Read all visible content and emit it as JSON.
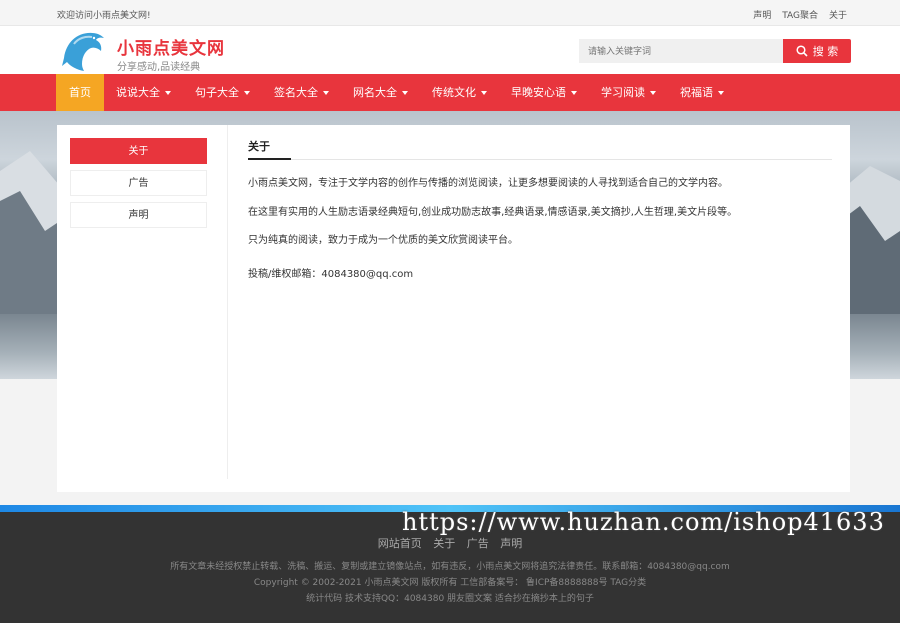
{
  "topbar": {
    "welcome": "欢迎访问小雨点美文网!",
    "links": [
      "声明",
      "TAG聚合",
      "关于"
    ]
  },
  "header": {
    "site_title": "小雨点美文网",
    "slogan": "分享感动,品读经典",
    "search_placeholder": "请输入关键字词",
    "search_button": "搜 索"
  },
  "nav": {
    "items": [
      {
        "label": "首页",
        "dropdown": false
      },
      {
        "label": "说说大全",
        "dropdown": true
      },
      {
        "label": "句子大全",
        "dropdown": true
      },
      {
        "label": "签名大全",
        "dropdown": true
      },
      {
        "label": "网名大全",
        "dropdown": true
      },
      {
        "label": "传统文化",
        "dropdown": true
      },
      {
        "label": "早晚安心语",
        "dropdown": true
      },
      {
        "label": "学习阅读",
        "dropdown": true
      },
      {
        "label": "祝福语",
        "dropdown": true
      }
    ]
  },
  "sidebar": {
    "items": [
      {
        "label": "关于"
      },
      {
        "label": "广告"
      },
      {
        "label": "声明"
      }
    ]
  },
  "main": {
    "title": "关于",
    "p1": "小雨点美文网，专注于文学内容的创作与传播的浏览阅读，让更多想要阅读的人寻找到适合自己的文学内容。",
    "p2": "在这里有实用的人生励志语录经典短句,创业成功励志故事,经典语录,情感语录,美文摘抄,人生哲理,美文片段等。",
    "p3": "只为纯真的阅读，致力于成为一个优质的美文欣赏阅读平台。",
    "p4": "投稿/维权邮箱：4084380@qq.com"
  },
  "footer": {
    "links": [
      "网站首页",
      "关于",
      "广告",
      "声明"
    ],
    "line1": "所有文章未经授权禁止转载、洗稿、搬运、复制或建立镜像站点，如有违反，小雨点美文网将追究法律责任。联系邮箱：4084380@qq.com",
    "line2": "Copyright © 2002-2021 小雨点美文网 版权所有 工信部备案号： 鲁ICP备8888888号   TAG分类",
    "line3": "统计代码 技术支持QQ：4084380  朋友圈文案  适合抄在摘抄本上的句子"
  },
  "watermark": "https://www.huzhan.com/ishop41633",
  "colors": {
    "brand_red": "#e8353d",
    "nav_active": "#f5a623",
    "footer_bg": "#333333"
  }
}
